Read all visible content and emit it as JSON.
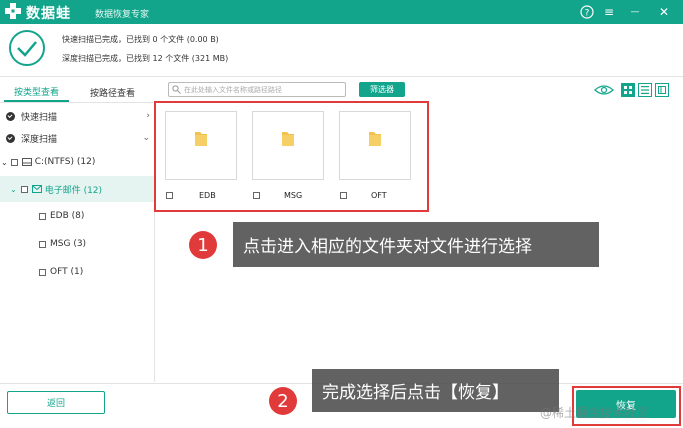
{
  "window": {
    "brand": "数据蛙",
    "subtitle": "数据恢复专家",
    "help_icon": "?",
    "menu_icon": "≡",
    "minimize_icon": "—",
    "close_icon": "✕"
  },
  "status": {
    "quick_scan": "快速扫描已完成，已找到 0 个文件 (0.00  B)",
    "deep_scan": "深度扫描已完成，已找到 12 个文件 (321 MB)"
  },
  "tabs": [
    "按类型查看",
    "按路径查看"
  ],
  "sidebar": {
    "scan_items": [
      {
        "label": "快速扫描",
        "chevron": "›"
      },
      {
        "label": "深度扫描",
        "chevron": "⌄"
      }
    ],
    "tree": [
      {
        "label": "C:(NTFS) (12)",
        "caret": "⌄"
      },
      {
        "label": "电子邮件 (12)",
        "caret": "⌄"
      },
      {
        "label": "EDB (8)"
      },
      {
        "label": "MSG (3)"
      },
      {
        "label": "OFT (1)"
      }
    ]
  },
  "search": {
    "placeholder": "在此处输入文件名称或路径路径"
  },
  "filter_label": "筛选器",
  "files": [
    {
      "name": "EDB"
    },
    {
      "name": "MSG"
    },
    {
      "name": "OFT"
    }
  ],
  "footer": {
    "back": "返回",
    "recover": "恢复"
  },
  "callouts": [
    {
      "number": "1",
      "text": "点击进入相应的文件夹对文件进行选择"
    },
    {
      "number": "2",
      "text": "完成选择后点击【恢复】"
    }
  ],
  "watermark": "@稀土掘金技术社区",
  "colors": {
    "accent": "#13a58c",
    "highlight": "#e03a3a"
  }
}
